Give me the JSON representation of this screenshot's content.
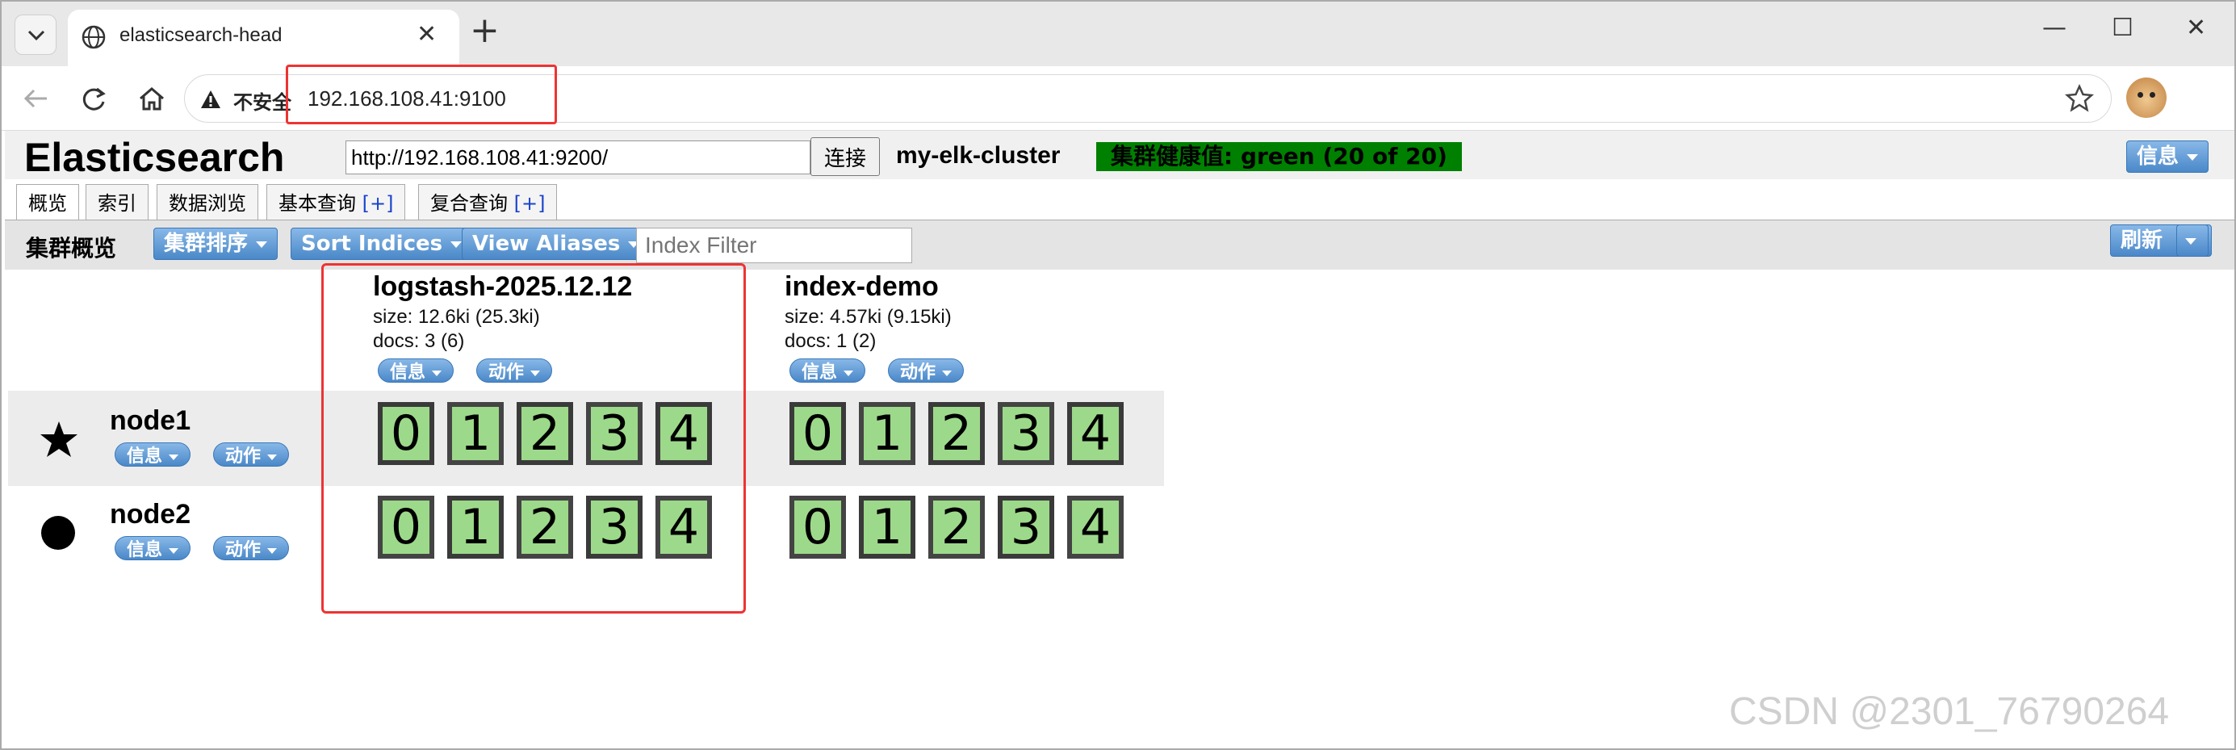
{
  "browser": {
    "tab_title": "elasticsearch-head",
    "insecure_label": "不安全",
    "url": "192.168.108.41:9100"
  },
  "header": {
    "logo": "Elasticsearch",
    "es_url": "http://192.168.108.41:9200/",
    "connect_label": "连接",
    "cluster_name": "my-elk-cluster",
    "health": "集群健康值: green (20 of 20)",
    "info_label": "信息"
  },
  "tabs": [
    {
      "label": "概览"
    },
    {
      "label": "索引"
    },
    {
      "label": "数据浏览"
    },
    {
      "label": "基本查询",
      "plus": "[+]"
    },
    {
      "label": "复合查询",
      "plus": "[+]"
    }
  ],
  "toolbar": {
    "title": "集群概览",
    "sort_cluster": "集群排序",
    "sort_indices": "Sort Indices",
    "view_aliases": "View Aliases",
    "index_filter_placeholder": "Index Filter",
    "refresh": "刷新"
  },
  "indices": [
    {
      "name": "logstash-2025.12.12",
      "size": "size: 12.6ki (25.3ki)",
      "docs": "docs: 3 (6)",
      "info": "信息",
      "action": "动作"
    },
    {
      "name": "index-demo",
      "size": "size: 4.57ki (9.15ki)",
      "docs": "docs: 1 (2)",
      "info": "信息",
      "action": "动作"
    }
  ],
  "nodes": [
    {
      "name": "node1",
      "info": "信息",
      "action": "动作",
      "icon": "star-icon",
      "shards": [
        "0",
        "1",
        "2",
        "3",
        "4"
      ]
    },
    {
      "name": "node2",
      "info": "信息",
      "action": "动作",
      "icon": "circle-icon",
      "shards": [
        "0",
        "1",
        "2",
        "3",
        "4"
      ]
    }
  ],
  "colors": {
    "health_green": "#008000",
    "shard_fill": "#9dd98a",
    "highlight_red": "#ee3333"
  },
  "watermark": "CSDN @2301_76790264"
}
